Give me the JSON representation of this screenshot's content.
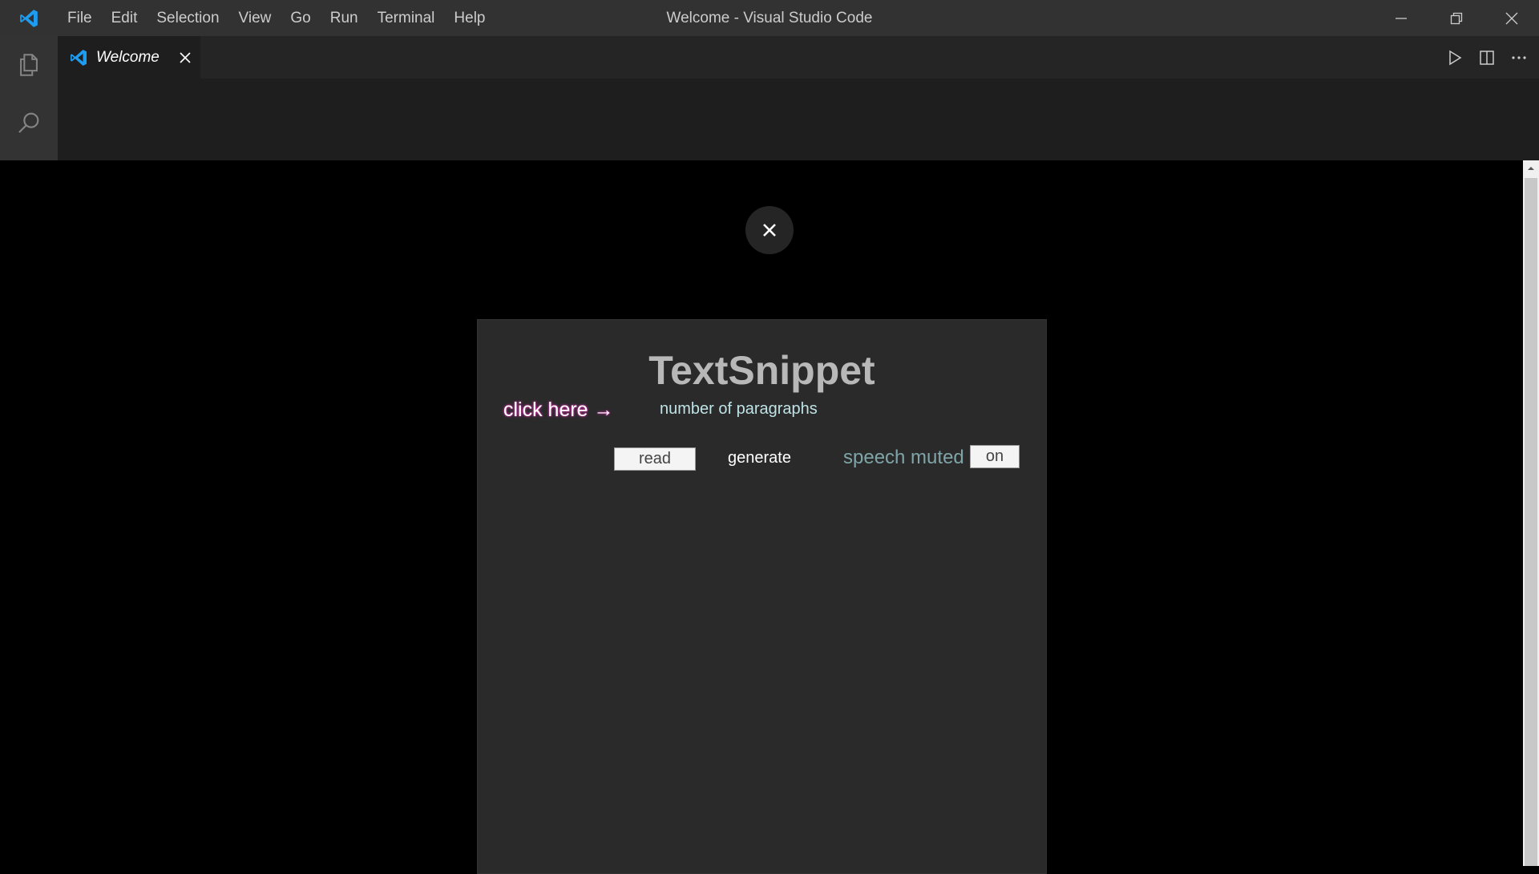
{
  "window": {
    "title": "Welcome - Visual Studio Code",
    "menu": [
      "File",
      "Edit",
      "Selection",
      "View",
      "Go",
      "Run",
      "Terminal",
      "Help"
    ]
  },
  "icons": {
    "app": "vscode-logo-icon",
    "activity": [
      "explorer-icon",
      "search-icon"
    ],
    "window_controls": [
      "minimize-icon",
      "restore-icon",
      "close-icon"
    ],
    "editor_actions": [
      "run-icon",
      "split-editor-icon",
      "more-actions-icon"
    ]
  },
  "tabs": [
    {
      "label": "Welcome",
      "active": true
    }
  ],
  "webview": {
    "title": "TextSnippet",
    "click_here": "click here →",
    "number_of_paragraphs": "number of paragraphs",
    "read_label": "read",
    "generate_label": "generate",
    "speech_label": "speech muted",
    "on_label": "on"
  },
  "colors": {
    "titlebar": "#323233",
    "activitybar": "#333333",
    "editor": "#1e1e1e",
    "panel": "#2a2a2a",
    "vscode_blue": "#1f9cf0"
  }
}
